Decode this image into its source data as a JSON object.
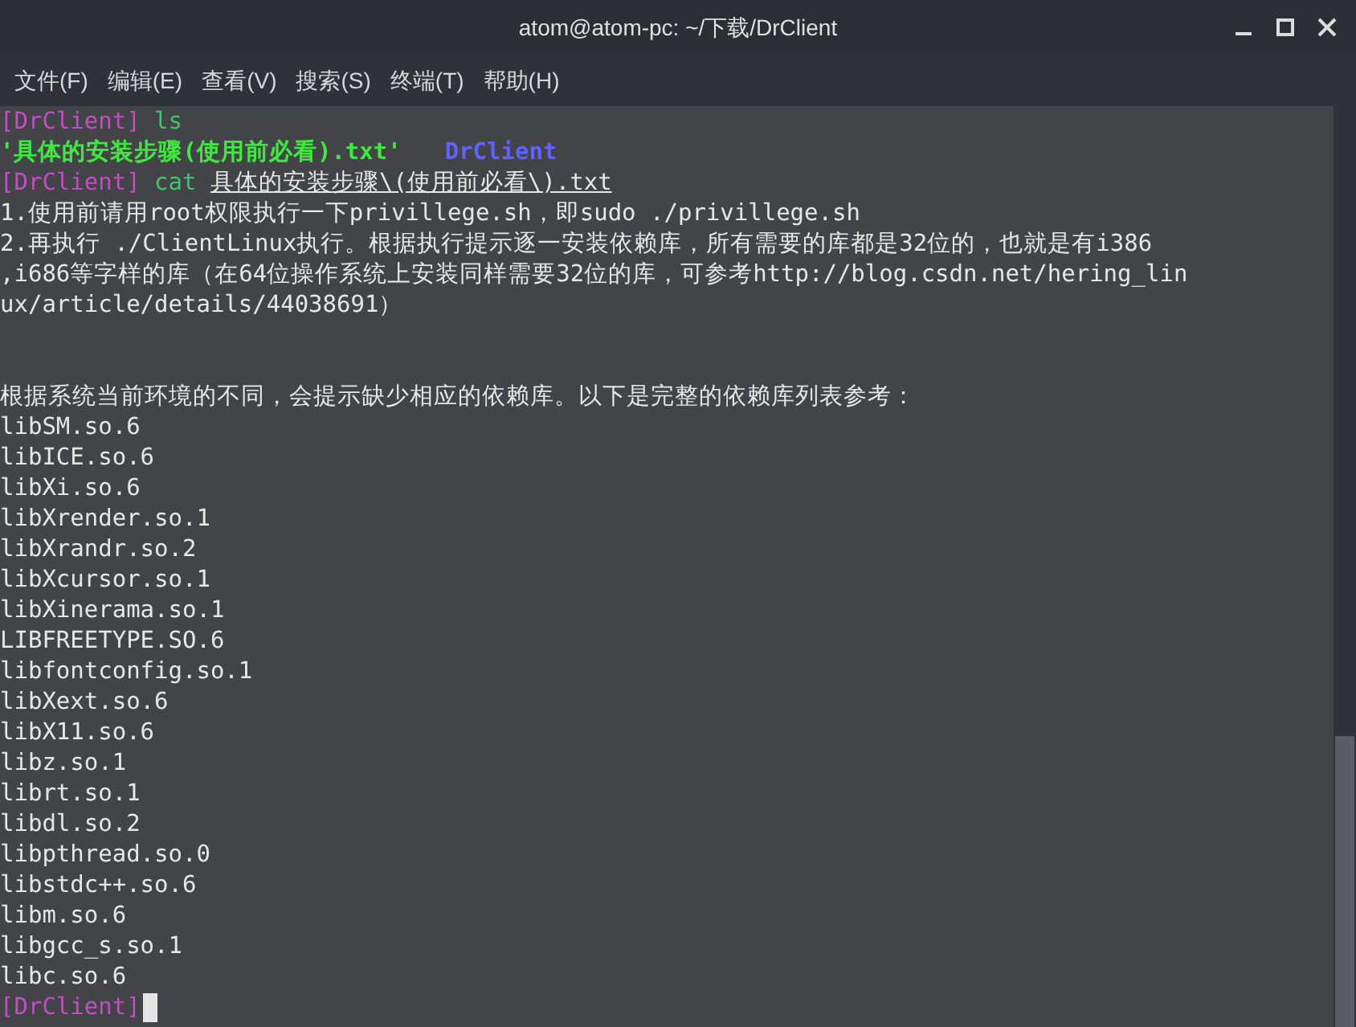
{
  "window": {
    "title": "atom@atom-pc: ~/下载/DrClient"
  },
  "menu": [
    "文件(F)",
    "编辑(E)",
    "查看(V)",
    "搜索(S)",
    "终端(T)",
    "帮助(H)"
  ],
  "terminal": {
    "lines": [
      {
        "segments": [
          {
            "kind": "prompt",
            "text": "[DrClient]"
          },
          {
            "kind": "command",
            "text": " ls"
          }
        ]
      },
      {
        "segments": [
          {
            "kind": "file",
            "text": "'具体的安装步骤(使用前必看).txt'"
          },
          {
            "kind": "directory",
            "text": "DrClient"
          }
        ]
      },
      {
        "segments": [
          {
            "kind": "prompt",
            "text": "[DrClient]"
          },
          {
            "kind": "command",
            "text": " cat "
          },
          {
            "kind": "path",
            "text": "具体的安装步骤\\(使用前必看\\).txt"
          }
        ]
      },
      {
        "segments": [
          {
            "kind": "plain",
            "text": "1.使用前请用root权限执行一下privillege.sh，即sudo ./privillege.sh"
          }
        ]
      },
      {
        "segments": [
          {
            "kind": "plain",
            "text": "2.再执行 ./ClientLinux执行。根据执行提示逐一安装依赖库，所有需要的库都是32位的，也就是有i386"
          }
        ]
      },
      {
        "segments": [
          {
            "kind": "plain",
            "text": ",i686等字样的库（在64位操作系统上安装同样需要32位的库，可参考http://blog.csdn.net/hering_lin"
          }
        ]
      },
      {
        "segments": [
          {
            "kind": "plain",
            "text": "ux/article/details/44038691）"
          }
        ]
      },
      {
        "blank_lines_before": true,
        "segments": [
          {
            "kind": "plain",
            "text": "根据系统当前环境的不同，会提示缺少相应的依赖库。以下是完整的依赖库列表参考："
          }
        ]
      },
      {
        "segments": [
          {
            "kind": "plain",
            "text": "libSM.so.6"
          }
        ]
      },
      {
        "segments": [
          {
            "kind": "plain",
            "text": "libICE.so.6"
          }
        ]
      },
      {
        "segments": [
          {
            "kind": "plain",
            "text": "libXi.so.6"
          }
        ]
      },
      {
        "segments": [
          {
            "kind": "plain",
            "text": "libXrender.so.1"
          }
        ]
      },
      {
        "segments": [
          {
            "kind": "plain",
            "text": "libXrandr.so.2"
          }
        ]
      },
      {
        "segments": [
          {
            "kind": "plain",
            "text": "libXcursor.so.1"
          }
        ]
      },
      {
        "segments": [
          {
            "kind": "plain",
            "text": "libXinerama.so.1"
          }
        ]
      },
      {
        "segments": [
          {
            "kind": "plain",
            "text": "LIBFREETYPE.SO.6"
          }
        ]
      },
      {
        "segments": [
          {
            "kind": "plain",
            "text": "libfontconfig.so.1"
          }
        ]
      },
      {
        "segments": [
          {
            "kind": "plain",
            "text": "libXext.so.6"
          }
        ]
      },
      {
        "segments": [
          {
            "kind": "plain",
            "text": "libX11.so.6"
          }
        ]
      },
      {
        "segments": [
          {
            "kind": "plain",
            "text": "libz.so.1"
          }
        ]
      },
      {
        "segments": [
          {
            "kind": "plain",
            "text": "librt.so.1"
          }
        ]
      },
      {
        "segments": [
          {
            "kind": "plain",
            "text": "libdl.so.2"
          }
        ]
      },
      {
        "segments": [
          {
            "kind": "plain",
            "text": "libpthread.so.0"
          }
        ]
      },
      {
        "segments": [
          {
            "kind": "plain",
            "text": "libstdc++.so.6"
          }
        ]
      },
      {
        "segments": [
          {
            "kind": "plain",
            "text": "libm.so.6"
          }
        ]
      },
      {
        "segments": [
          {
            "kind": "plain",
            "text": "libgcc_s.so.1"
          }
        ]
      },
      {
        "segments": [
          {
            "kind": "plain",
            "text": "libc.so.6"
          }
        ]
      },
      {
        "cursor": true,
        "segments": [
          {
            "kind": "prompt",
            "text": "[DrClient]"
          }
        ]
      }
    ]
  }
}
